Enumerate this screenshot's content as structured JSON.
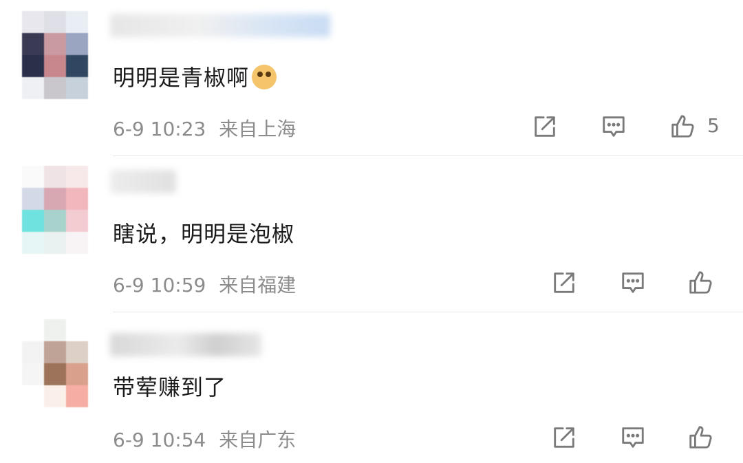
{
  "comments": [
    {
      "text": "明明是青椒啊",
      "emoji": "doge-emoji",
      "time": "6-9 10:23",
      "location": "来自上海",
      "like_count": "5"
    },
    {
      "text": "瞎说，明明是泡椒",
      "time": "6-9 10:59",
      "location": "来自福建",
      "like_count": ""
    },
    {
      "text": "带荤赚到了",
      "time": "6-9 10:54",
      "location": "来自广东",
      "like_count": ""
    }
  ],
  "icons": {
    "share": "share-icon",
    "reply": "comment-icon",
    "like": "thumbs-up-icon"
  },
  "colors": {
    "meta_text": "#8c8c8c",
    "icon": "#7a7a7a",
    "divider": "#e6e6e6"
  }
}
